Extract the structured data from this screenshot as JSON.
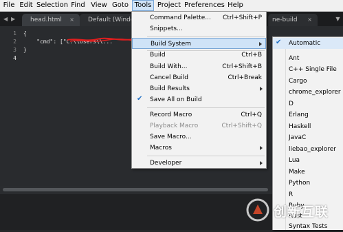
{
  "menubar": {
    "items": [
      "File",
      "Edit",
      "Selection",
      "Find",
      "View",
      "Goto",
      "Tools",
      "Project",
      "Preferences",
      "Help"
    ],
    "open_item": "Tools"
  },
  "tabs": {
    "nav_left": "◀",
    "nav_right": "▶",
    "items": [
      {
        "label": "head.html",
        "close": "×"
      },
      {
        "label": "Default (Windo",
        "close": "×"
      },
      {
        "label": "ne-build",
        "close": "×"
      }
    ],
    "overflow": "▼"
  },
  "editor": {
    "line_numbers": [
      "1",
      "2",
      "3",
      "4"
    ],
    "lines": [
      "{",
      "    \"cmd\": [\"C:\\\\Users\\\\...",
      "}",
      ""
    ]
  },
  "tools_menu": {
    "items": [
      {
        "label": "Command Palette...",
        "shortcut": "Ctrl+Shift+P"
      },
      {
        "label": "Snippets...",
        "shortcut": ""
      },
      {
        "label": "Build System",
        "shortcut": "",
        "submenu": true,
        "highlighted": true
      },
      {
        "label": "Build",
        "shortcut": "Ctrl+B"
      },
      {
        "label": "Build With...",
        "shortcut": "Ctrl+Shift+B"
      },
      {
        "label": "Cancel Build",
        "shortcut": "Ctrl+Break"
      },
      {
        "label": "Build Results",
        "shortcut": "",
        "submenu": true
      },
      {
        "label": "Save All on Build",
        "shortcut": "",
        "checked": true
      },
      {
        "label": "Record Macro",
        "shortcut": "Ctrl+Q"
      },
      {
        "label": "Playback Macro",
        "shortcut": "Ctrl+Shift+Q",
        "disabled": true
      },
      {
        "label": "Save Macro...",
        "shortcut": ""
      },
      {
        "label": "Macros",
        "shortcut": "",
        "submenu": true
      },
      {
        "label": "Developer",
        "shortcut": "",
        "submenu": true
      }
    ]
  },
  "build_system_menu": {
    "items": [
      {
        "label": "Automatic",
        "checked": true
      },
      {
        "label": "Ant"
      },
      {
        "label": "C++ Single File"
      },
      {
        "label": "Cargo"
      },
      {
        "label": "chrome_explorer"
      },
      {
        "label": "D"
      },
      {
        "label": "Erlang"
      },
      {
        "label": "Haskell"
      },
      {
        "label": "JavaC"
      },
      {
        "label": "liebao_explorer"
      },
      {
        "label": "Lua"
      },
      {
        "label": "Make"
      },
      {
        "label": "Python"
      },
      {
        "label": "R"
      },
      {
        "label": "Ruby"
      },
      {
        "label": "Rust"
      },
      {
        "label": "Syntax Tests"
      }
    ]
  },
  "watermark": {
    "text": "创新互联"
  },
  "colors": {
    "menu_highlight": "#cfe3f7",
    "check": "#1f6fc5",
    "editor_bg": "#292b2e",
    "scribble": "#e01e1e"
  },
  "icons": {
    "check": "✔"
  }
}
